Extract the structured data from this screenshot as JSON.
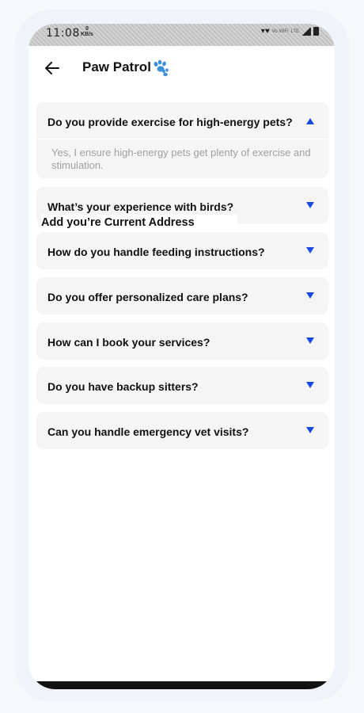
{
  "status_bar": {
    "time": "11:08",
    "speed_value": "0",
    "speed_unit": "KB/s",
    "network": "Vo WiFi",
    "lte": "LTE"
  },
  "header": {
    "title": "Paw Patrol",
    "back_icon": "arrow-left-icon",
    "title_icon": "paw-icon"
  },
  "faq": [
    {
      "question": "Do you provide exercise for high-energy pets?",
      "answer": "Yes, I ensure high-energy pets get plenty of exercise and stimulation.",
      "expanded": true
    },
    {
      "question": "What’s your experience with birds?",
      "expanded": false
    },
    {
      "question": "How do you handle feeding instructions?",
      "expanded": false
    },
    {
      "question": "Do you offer personalized care plans?",
      "expanded": false
    },
    {
      "question": "How can I book your services?",
      "expanded": false
    },
    {
      "question": "Do you have backup sitters?",
      "expanded": false
    },
    {
      "question": "Can you handle emergency vet visits?",
      "expanded": false
    }
  ],
  "overlay_label": "Add you’re Current Address",
  "colors": {
    "accent": "#1a49e8",
    "card_bg": "#f5f5f5",
    "answer_text": "#a0a0a0"
  }
}
